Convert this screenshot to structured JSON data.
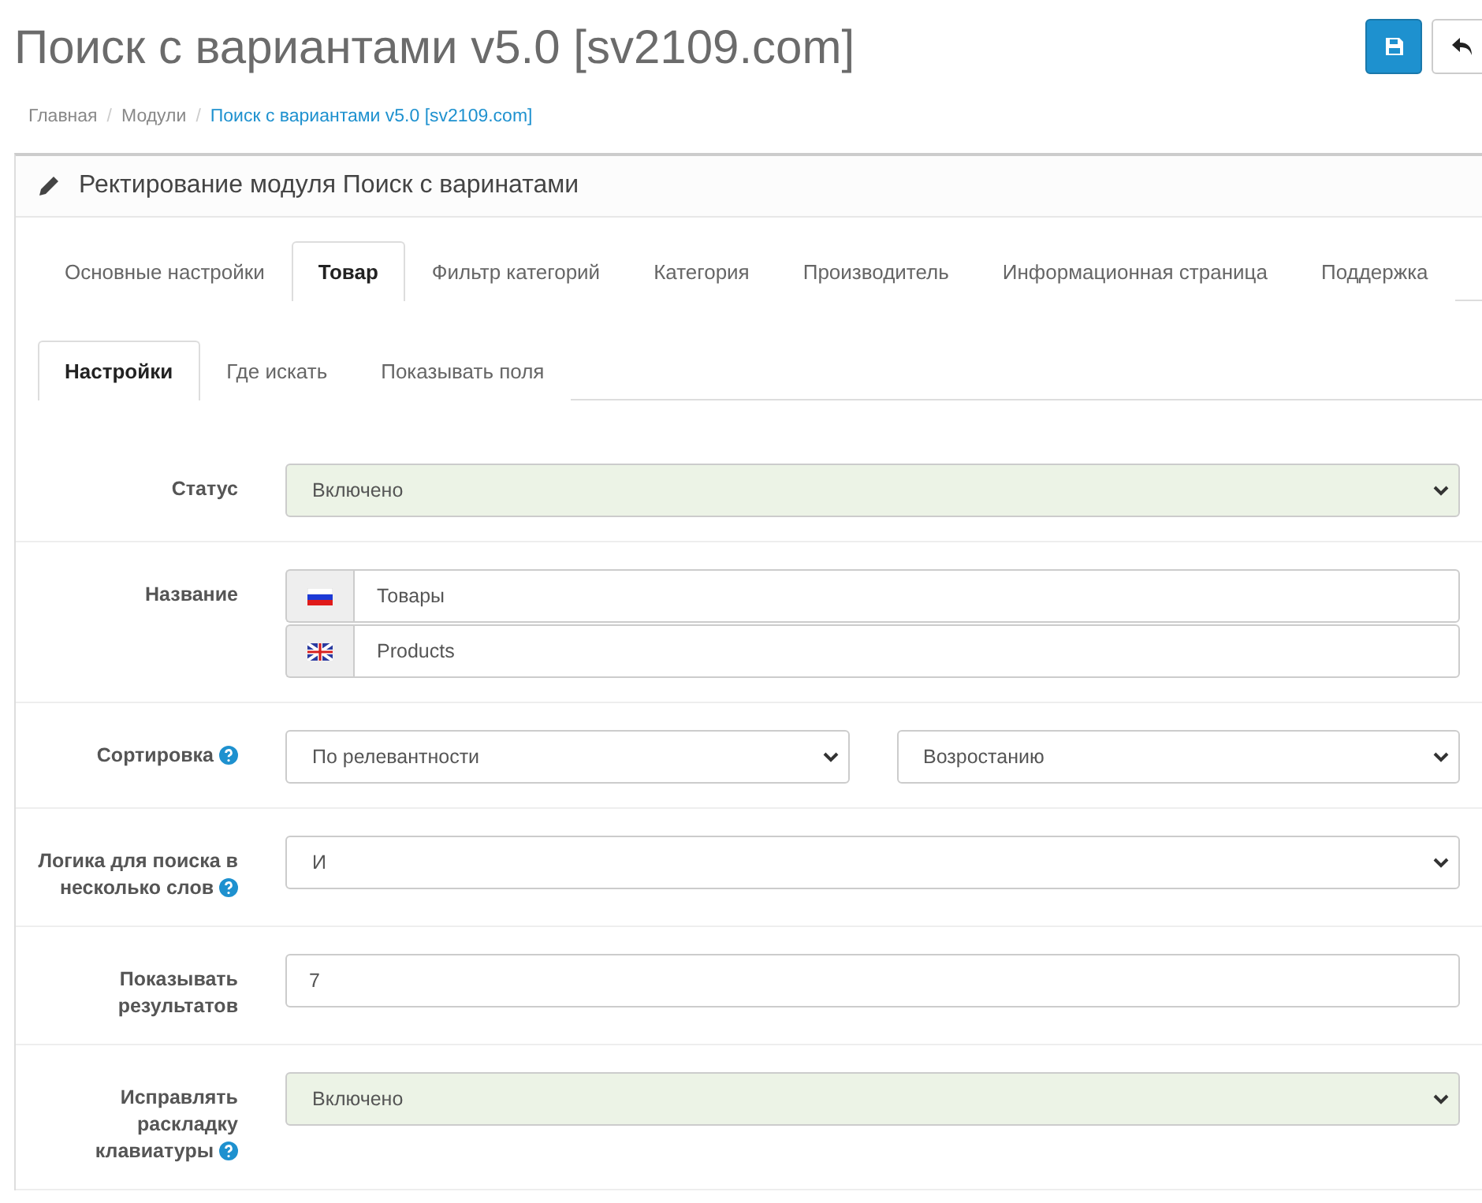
{
  "page_title": "Поиск с вариантами v5.0 [sv2109.com]",
  "header_buttons": [
    {
      "kind": "save",
      "primary": true
    },
    {
      "kind": "back",
      "primary": false
    }
  ],
  "breadcrumb_separator": "/",
  "breadcrumb": [
    {
      "label": "Главная",
      "current": false
    },
    {
      "label": "Модули",
      "current": false
    },
    {
      "label": "Поиск с вариантами v5.0 [sv2109.com]",
      "current": true
    }
  ],
  "panel_title": "Ректирование модуля Поиск с варинатами",
  "tabs": [
    {
      "label": "Основные настройки",
      "selected": false
    },
    {
      "label": "Товар",
      "selected": true
    },
    {
      "label": "Фильтр категорий",
      "selected": false
    },
    {
      "label": "Категория",
      "selected": false
    },
    {
      "label": "Производитель",
      "selected": false
    },
    {
      "label": "Информационная страница",
      "selected": false
    },
    {
      "label": "Поддержка",
      "selected": false
    }
  ],
  "subtabs": [
    {
      "label": "Настройки",
      "selected": true
    },
    {
      "label": "Где искать",
      "selected": false
    },
    {
      "label": "Показывать поля",
      "selected": false
    }
  ],
  "fields": [
    {
      "kind": "select",
      "label": "Статус",
      "help": false,
      "value": "Включено",
      "success": true
    },
    {
      "kind": "lang-inputs",
      "label": "Название",
      "help": false,
      "inputs": [
        {
          "kind": "ru",
          "value": "Товары"
        },
        {
          "kind": "en",
          "value": "Products"
        }
      ]
    },
    {
      "kind": "select-pair",
      "label": "Сортировка",
      "help": true,
      "selects": [
        {
          "value": "По релевантности",
          "success": false
        },
        {
          "value": "Возростанию",
          "success": false
        }
      ]
    },
    {
      "kind": "select",
      "label": "Логика для поиска в несколько слов",
      "help": true,
      "value": "И",
      "success": false
    },
    {
      "kind": "input",
      "label": "Показывать результатов",
      "help": false,
      "value": "7"
    },
    {
      "kind": "select",
      "label": "Исправлять раскладку клавиатуры",
      "help": true,
      "value": "Включено",
      "success": true
    }
  ]
}
